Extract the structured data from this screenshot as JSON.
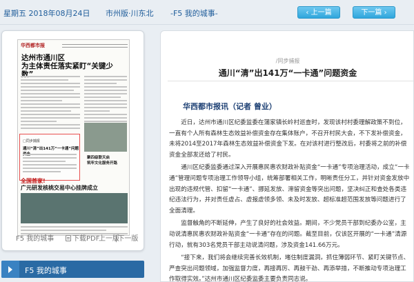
{
  "topbar": {
    "date": "星期五 2018年08月24日",
    "edition": "市州版·川东北",
    "page": "-F5 我的城事-",
    "prev_label": "上一篇",
    "next_label": "下一篇"
  },
  "newspaper": {
    "masthead": "华西都市报",
    "headline_line1": "达州市通川区",
    "headline_line2": "为主体责任落实紧盯“关键少数”",
    "highlight_kicker": "□同步捕报",
    "highlight_title": "通川“清”出141万“一卡通”问题资金",
    "red_headline_part1": "全国首家!",
    "red_headline_part2": "广元研发核桃交易中心挂牌成立",
    "side_title": "聚四级联天启",
    "side_title2": "筑牢文化服务开路"
  },
  "left_footer": {
    "page_label": "F5 我的城事",
    "download_label": "下载PDF",
    "prev_page_label": "上一版",
    "next_page_label": "下一版"
  },
  "section": {
    "label": "F5  我的城事"
  },
  "article": {
    "rubric": "/同步捕报",
    "title": "通川“清”出141万“一卡通”问题资金",
    "byline": "华西都市报讯（记者 曾业）",
    "paragraphs": [
      "近日，达州市通川区纪委监委在蒲家镇长岭村巡查时，发现该村村委理解政策不到位，一直有个人所有森林生态效益补偿资金存在集体账户，不召开村民大会，不下发补偿资金，未将2014至2017年森林生态效益补偿资金下发。在对该村进行整改后，村委将之前的补偿资金全部发还给了村民。",
      "通川区纪委监委通过深入开展惠民惠农财政补贴资金“一卡通”专项治理活动，成立“一卡通”管理问题专项治理工作领导小组，统筹部署相关工作，明晰责任分工，并针对资金发放中出现的违规代管、扣留“一卡通”、挪延发放、滞留资金等突出问题，坚决纠正和查处各类违纪违法行为，并对责任虚占、虚报虚领多领、未及时发放、超标准超范围发放等问题进行了全面清理。",
      "监督触角的不断延伸，产生了良好的社会效益。期间，不少党员干部到纪委办公室，主动说清惠民惠农财政补贴资金“一卡通”存在的问题。截至目前，仅该区开展的“一卡通”清源行动，就有303名党员干部主动说清问题，涉及资金141.66万元。",
      "“接下来，我们将会继续完善长效机制，堵住制度漏洞，抓住薄弱环节、紧盯关键节点、严查突出问题领域，加强监督力度，再接再厉、再鼓干劲、再添举措，不断推动专项治理工作取得实效。”达州市通川区纪委监委主要负责同志说。"
    ]
  }
}
